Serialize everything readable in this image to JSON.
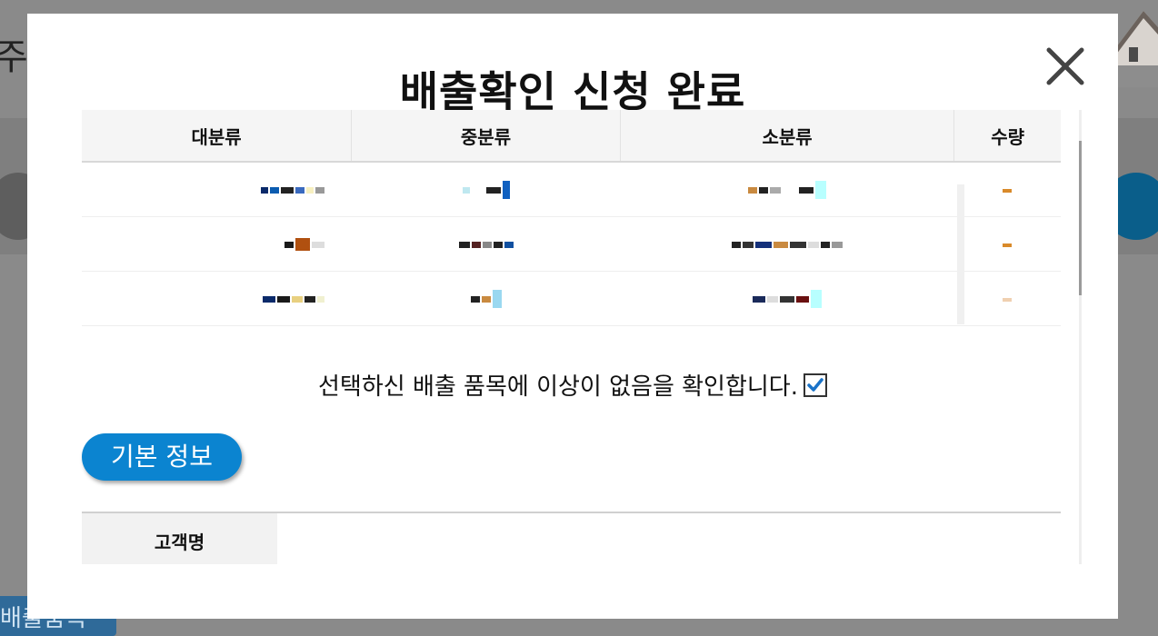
{
  "background": {
    "title_fragment": "주흠",
    "bottom_button_label": "배출품목"
  },
  "modal": {
    "title": "배출확인 신청 완료",
    "close_icon": "close-icon",
    "table": {
      "headers": [
        "대분류",
        "중분류",
        "소분류",
        "수량"
      ],
      "row_count": 3,
      "cell_values_redacted": true
    },
    "confirm_text": "선택하신 배출 품목에 이상이 없음을 확인합니다.",
    "confirm_checked": true,
    "section_button_label": "기본 정보",
    "info_fields": [
      {
        "label": "고객명",
        "value": ""
      }
    ]
  },
  "colors": {
    "accent": "#0b84d0",
    "overlay": "#8a8a8a",
    "checkmark": "#1a73c8"
  }
}
